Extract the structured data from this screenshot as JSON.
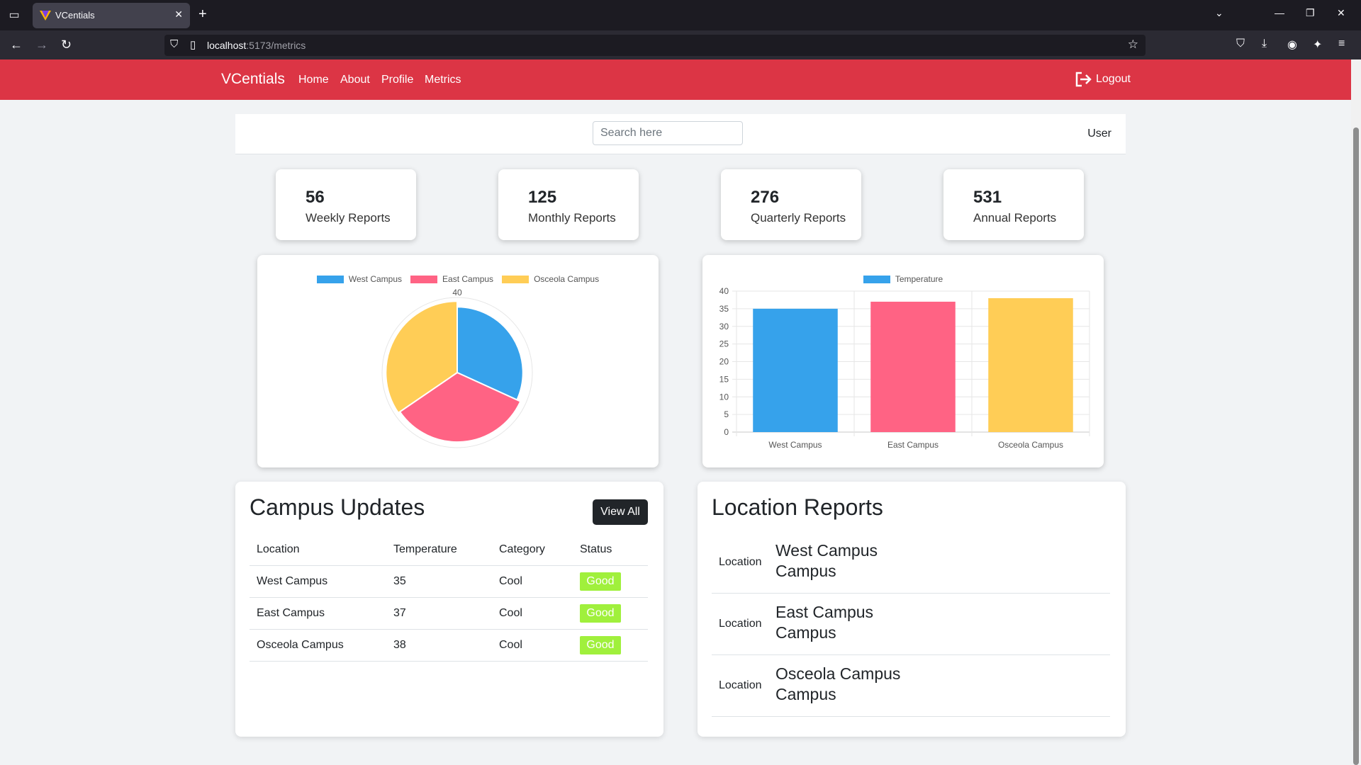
{
  "browser": {
    "tab_title": "VCentials",
    "url_host": "localhost",
    "url_rest": ":5173/metrics"
  },
  "navbar": {
    "brand": "VCentials",
    "links": [
      "Home",
      "About",
      "Profile",
      "Metrics"
    ],
    "logout": "Logout"
  },
  "header": {
    "search_placeholder": "Search here",
    "user": "User"
  },
  "stats": [
    {
      "value": "56",
      "label": "Weekly Reports"
    },
    {
      "value": "125",
      "label": "Monthly Reports"
    },
    {
      "value": "276",
      "label": "Quarterly Reports"
    },
    {
      "value": "531",
      "label": "Annual Reports"
    }
  ],
  "colors": {
    "blue": "#36a2eb",
    "pink": "#ff6384",
    "yellow": "#ffcd56",
    "brand": "#dc3545"
  },
  "chart_data": [
    {
      "type": "pie",
      "categories": [
        "West Campus",
        "East Campus",
        "Osceola Campus"
      ],
      "values": [
        35,
        37,
        38
      ],
      "radial_tick_label": "40",
      "colors": [
        "#36a2eb",
        "#ff6384",
        "#ffcd56"
      ]
    },
    {
      "type": "bar",
      "categories": [
        "West Campus",
        "East Campus",
        "Osceola Campus"
      ],
      "series": [
        {
          "name": "Temperature",
          "values": [
            35,
            37,
            38
          ]
        }
      ],
      "colors": [
        "#36a2eb",
        "#ff6384",
        "#ffcd56"
      ],
      "ylim": [
        0,
        40
      ],
      "yticks": [
        0,
        5,
        10,
        15,
        20,
        25,
        30,
        35,
        40
      ],
      "grid": true,
      "legend": "top"
    }
  ],
  "updates": {
    "title": "Campus Updates",
    "view_all": "View All",
    "columns": [
      "Location",
      "Temperature",
      "Category",
      "Status"
    ],
    "rows": [
      [
        "West Campus",
        "35",
        "Cool",
        "Good"
      ],
      [
        "East Campus",
        "37",
        "Cool",
        "Good"
      ],
      [
        "Osceola Campus",
        "38",
        "Cool",
        "Good"
      ]
    ]
  },
  "reports": {
    "title": "Location Reports",
    "items": [
      {
        "label": "Location",
        "name_line1": "West Campus",
        "name_line2": "Campus"
      },
      {
        "label": "Location",
        "name_line1": "East Campus",
        "name_line2": "Campus"
      },
      {
        "label": "Location",
        "name_line1": "Osceola Campus",
        "name_line2": "Campus"
      }
    ]
  }
}
